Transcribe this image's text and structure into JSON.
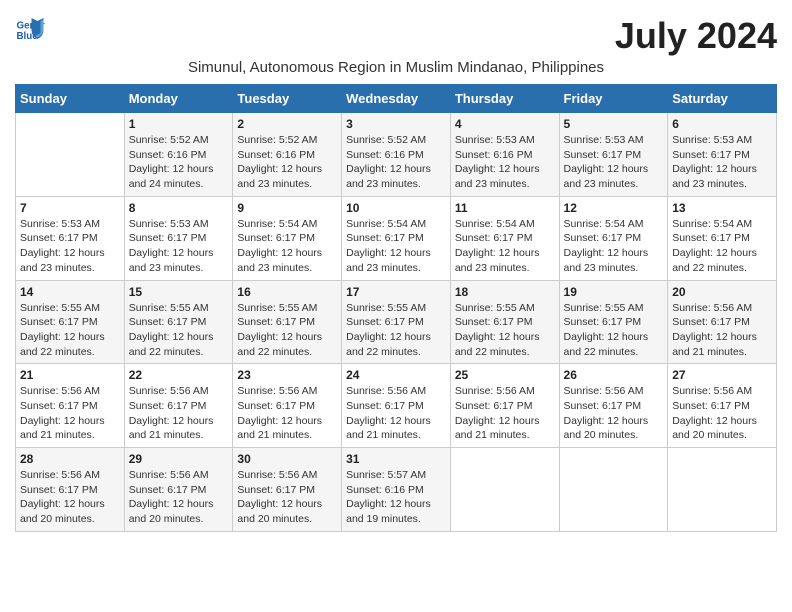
{
  "header": {
    "logo_line1": "General",
    "logo_line2": "Blue",
    "month_title": "July 2024",
    "location": "Simunul, Autonomous Region in Muslim Mindanao, Philippines"
  },
  "days_of_week": [
    "Sunday",
    "Monday",
    "Tuesday",
    "Wednesday",
    "Thursday",
    "Friday",
    "Saturday"
  ],
  "weeks": [
    [
      {
        "day": "",
        "info": ""
      },
      {
        "day": "1",
        "info": "Sunrise: 5:52 AM\nSunset: 6:16 PM\nDaylight: 12 hours\nand 24 minutes."
      },
      {
        "day": "2",
        "info": "Sunrise: 5:52 AM\nSunset: 6:16 PM\nDaylight: 12 hours\nand 23 minutes."
      },
      {
        "day": "3",
        "info": "Sunrise: 5:52 AM\nSunset: 6:16 PM\nDaylight: 12 hours\nand 23 minutes."
      },
      {
        "day": "4",
        "info": "Sunrise: 5:53 AM\nSunset: 6:16 PM\nDaylight: 12 hours\nand 23 minutes."
      },
      {
        "day": "5",
        "info": "Sunrise: 5:53 AM\nSunset: 6:17 PM\nDaylight: 12 hours\nand 23 minutes."
      },
      {
        "day": "6",
        "info": "Sunrise: 5:53 AM\nSunset: 6:17 PM\nDaylight: 12 hours\nand 23 minutes."
      }
    ],
    [
      {
        "day": "7",
        "info": "Sunrise: 5:53 AM\nSunset: 6:17 PM\nDaylight: 12 hours\nand 23 minutes."
      },
      {
        "day": "8",
        "info": "Sunrise: 5:53 AM\nSunset: 6:17 PM\nDaylight: 12 hours\nand 23 minutes."
      },
      {
        "day": "9",
        "info": "Sunrise: 5:54 AM\nSunset: 6:17 PM\nDaylight: 12 hours\nand 23 minutes."
      },
      {
        "day": "10",
        "info": "Sunrise: 5:54 AM\nSunset: 6:17 PM\nDaylight: 12 hours\nand 23 minutes."
      },
      {
        "day": "11",
        "info": "Sunrise: 5:54 AM\nSunset: 6:17 PM\nDaylight: 12 hours\nand 23 minutes."
      },
      {
        "day": "12",
        "info": "Sunrise: 5:54 AM\nSunset: 6:17 PM\nDaylight: 12 hours\nand 23 minutes."
      },
      {
        "day": "13",
        "info": "Sunrise: 5:54 AM\nSunset: 6:17 PM\nDaylight: 12 hours\nand 22 minutes."
      }
    ],
    [
      {
        "day": "14",
        "info": "Sunrise: 5:55 AM\nSunset: 6:17 PM\nDaylight: 12 hours\nand 22 minutes."
      },
      {
        "day": "15",
        "info": "Sunrise: 5:55 AM\nSunset: 6:17 PM\nDaylight: 12 hours\nand 22 minutes."
      },
      {
        "day": "16",
        "info": "Sunrise: 5:55 AM\nSunset: 6:17 PM\nDaylight: 12 hours\nand 22 minutes."
      },
      {
        "day": "17",
        "info": "Sunrise: 5:55 AM\nSunset: 6:17 PM\nDaylight: 12 hours\nand 22 minutes."
      },
      {
        "day": "18",
        "info": "Sunrise: 5:55 AM\nSunset: 6:17 PM\nDaylight: 12 hours\nand 22 minutes."
      },
      {
        "day": "19",
        "info": "Sunrise: 5:55 AM\nSunset: 6:17 PM\nDaylight: 12 hours\nand 22 minutes."
      },
      {
        "day": "20",
        "info": "Sunrise: 5:56 AM\nSunset: 6:17 PM\nDaylight: 12 hours\nand 21 minutes."
      }
    ],
    [
      {
        "day": "21",
        "info": "Sunrise: 5:56 AM\nSunset: 6:17 PM\nDaylight: 12 hours\nand 21 minutes."
      },
      {
        "day": "22",
        "info": "Sunrise: 5:56 AM\nSunset: 6:17 PM\nDaylight: 12 hours\nand 21 minutes."
      },
      {
        "day": "23",
        "info": "Sunrise: 5:56 AM\nSunset: 6:17 PM\nDaylight: 12 hours\nand 21 minutes."
      },
      {
        "day": "24",
        "info": "Sunrise: 5:56 AM\nSunset: 6:17 PM\nDaylight: 12 hours\nand 21 minutes."
      },
      {
        "day": "25",
        "info": "Sunrise: 5:56 AM\nSunset: 6:17 PM\nDaylight: 12 hours\nand 21 minutes."
      },
      {
        "day": "26",
        "info": "Sunrise: 5:56 AM\nSunset: 6:17 PM\nDaylight: 12 hours\nand 20 minutes."
      },
      {
        "day": "27",
        "info": "Sunrise: 5:56 AM\nSunset: 6:17 PM\nDaylight: 12 hours\nand 20 minutes."
      }
    ],
    [
      {
        "day": "28",
        "info": "Sunrise: 5:56 AM\nSunset: 6:17 PM\nDaylight: 12 hours\nand 20 minutes."
      },
      {
        "day": "29",
        "info": "Sunrise: 5:56 AM\nSunset: 6:17 PM\nDaylight: 12 hours\nand 20 minutes."
      },
      {
        "day": "30",
        "info": "Sunrise: 5:56 AM\nSunset: 6:17 PM\nDaylight: 12 hours\nand 20 minutes."
      },
      {
        "day": "31",
        "info": "Sunrise: 5:57 AM\nSunset: 6:16 PM\nDaylight: 12 hours\nand 19 minutes."
      },
      {
        "day": "",
        "info": ""
      },
      {
        "day": "",
        "info": ""
      },
      {
        "day": "",
        "info": ""
      }
    ]
  ]
}
